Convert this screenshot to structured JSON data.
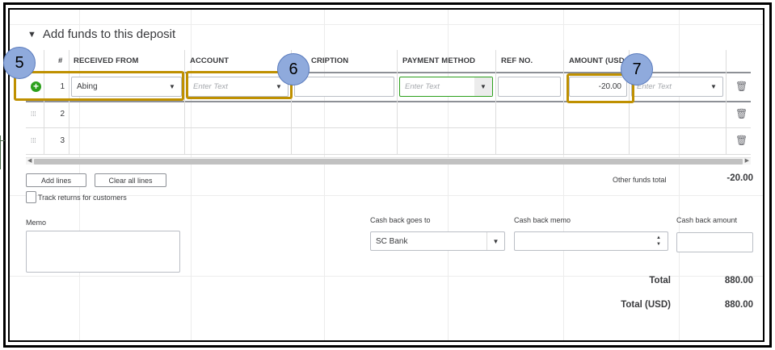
{
  "section": {
    "title": "Add funds to this deposit",
    "caret": "▼"
  },
  "columns": [
    "#",
    "RECEIVED FROM",
    "ACCOUNT",
    "CRIPTION",
    "PAYMENT METHOD",
    "REF NO.",
    "AMOUNT (USD"
  ],
  "rows": [
    {
      "num": "1",
      "received_from": "Abing",
      "account_placeholder": "Enter Text",
      "payment_placeholder": "Enter Text",
      "amount": "-20.00",
      "extra_placeholder": "Enter Text"
    },
    {
      "num": "2"
    },
    {
      "num": "3"
    }
  ],
  "icons": {
    "add": "plus-circle-icon",
    "drag": "drag-handle-icon",
    "delete": "trash-icon",
    "dropdown": "chevron-down-icon"
  },
  "buttons": {
    "add_lines": "Add lines",
    "clear_all_lines": "Clear all lines"
  },
  "track_returns": "Track returns for customers",
  "other_funds": {
    "label": "Other funds total",
    "value": "-20.00"
  },
  "memo": {
    "label": "Memo"
  },
  "cash_back": {
    "goes_to_label": "Cash back goes to",
    "goes_to_value": "SC Bank",
    "memo_label": "Cash back memo",
    "amount_label": "Cash back amount"
  },
  "totals": {
    "total_label": "Total",
    "total_value": "880.00",
    "total_usd_label": "Total (USD)",
    "total_usd_value": "880.00"
  },
  "callouts": [
    "5",
    "6",
    "7"
  ],
  "colors": {
    "highlight": "#bf9000",
    "callout_fill": "#8faadc",
    "green_accent": "#2ca01c"
  }
}
